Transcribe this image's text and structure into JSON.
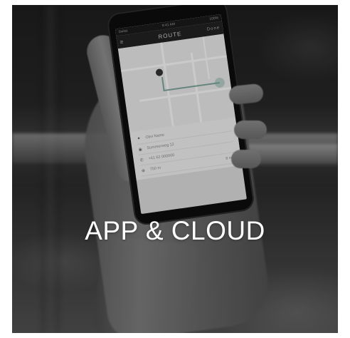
{
  "headline": "APP & CLOUD",
  "phone": {
    "status_left": "Swiss",
    "status_time": "9:41 AM",
    "status_right": "100%",
    "app_title": "ROUTE",
    "menu_icon": "menu-icon",
    "done_label": "Done",
    "details": [
      {
        "icon": "person-icon",
        "glyph": "●",
        "text": "Olivi Name"
      },
      {
        "icon": "location-pin-icon",
        "glyph": "◉",
        "text": "Summerweg 12"
      },
      {
        "icon": "phone-icon",
        "glyph": "✆",
        "text": "+41 62 000000"
      },
      {
        "icon": "distance-icon",
        "glyph": "⊕",
        "text": "750 m",
        "extra": "8 min"
      }
    ]
  },
  "colors": {
    "route": "#7ea39b",
    "overlay_text": "#ffffff"
  }
}
